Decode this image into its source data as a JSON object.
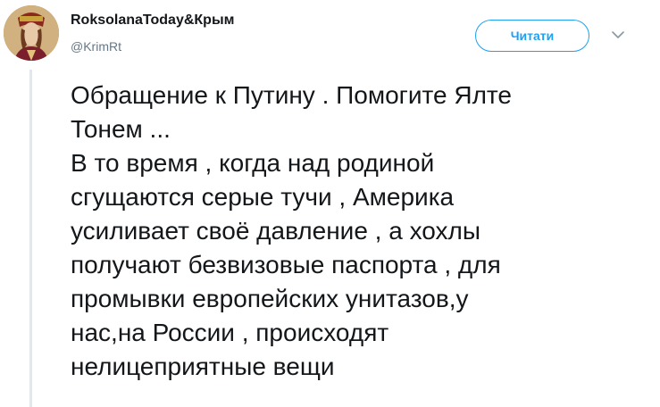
{
  "header": {
    "display_name": "RoksolanaToday&Крым",
    "handle": "@KrimRt",
    "follow_label": "Читати",
    "avatar_icon": "user-avatar-icon",
    "menu_icon": "chevron-down-icon"
  },
  "tweet": {
    "lines": [
      "Обращение к Путину . Помогите Ялте",
      "Тонем ...",
      "В то время , когда над родиной",
      "сгущаются серые тучи , Америка",
      "усиливает своё давление , а хохлы",
      "получают безвизовые паспорта , для",
      "промывки европейских унитазов,у",
      "нас,на России , происходят",
      "нелицеприятные вещи"
    ]
  },
  "colors": {
    "accent": "#1da1f2",
    "secondary_text": "#657786",
    "thread_line": "#e1e8ed"
  }
}
